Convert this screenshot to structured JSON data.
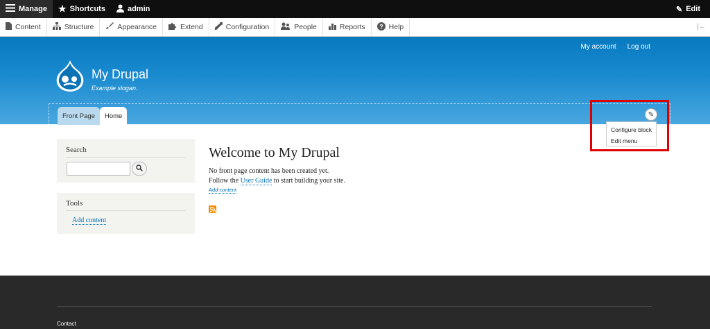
{
  "toolbar": {
    "manage": "Manage",
    "shortcuts": "Shortcuts",
    "user": "admin",
    "edit": "Edit"
  },
  "tray": {
    "items": [
      {
        "label": "Content",
        "icon": "page-icon"
      },
      {
        "label": "Structure",
        "icon": "sitemap-icon"
      },
      {
        "label": "Appearance",
        "icon": "brush-icon"
      },
      {
        "label": "Extend",
        "icon": "puzzle-icon"
      },
      {
        "label": "Configuration",
        "icon": "wrench-icon"
      },
      {
        "label": "People",
        "icon": "people-icon"
      },
      {
        "label": "Reports",
        "icon": "bar-chart-icon"
      },
      {
        "label": "Help",
        "icon": "question-icon"
      }
    ]
  },
  "header": {
    "secondary_menu": [
      "My account",
      "Log out"
    ],
    "site_name": "My Drupal",
    "slogan": "Example slogan.",
    "tabs": [
      "Front Page",
      "Home"
    ]
  },
  "contextual": {
    "items": [
      "Configure block",
      "Edit menu"
    ],
    "highlight_color": "#dd0000"
  },
  "sidebar": {
    "search_title": "Search",
    "tools_title": "Tools",
    "tools_link": "Add content"
  },
  "main": {
    "title": "Welcome to My Drupal",
    "line1": "No front page content has been created yet.",
    "line2_prefix": "Follow the",
    "line2_link": "User Guide",
    "line2_suffix": "to start building your site.",
    "add_content": "Add content"
  },
  "footer": {
    "contact": "Contact"
  },
  "colors": {
    "header_blue": "#0779bf",
    "link": "#0071b3",
    "footer": "#292929"
  }
}
